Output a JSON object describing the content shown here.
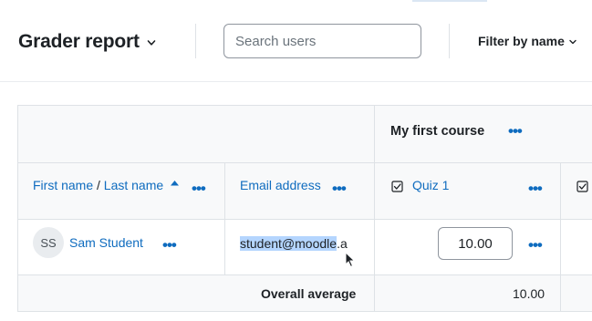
{
  "header": {
    "report_title": "Grader report",
    "search_placeholder": "Search users",
    "filter_label": "Filter by name"
  },
  "grid": {
    "course_name": "My first course",
    "columns": {
      "name": {
        "first": "First name",
        "separator": " / ",
        "last": "Last name"
      },
      "email": "Email address",
      "quiz": "Quiz 1"
    },
    "rows": [
      {
        "initials": "SS",
        "name": "Sam Student",
        "email_selected": "student@moodle",
        "email_rest": ".a",
        "grade": "10.00"
      }
    ],
    "average_label": "Overall average",
    "average_value": "10.00"
  },
  "colors": {
    "link": "#0f6cbf",
    "header_fill": "#f8f9fa",
    "border": "#dee2e6",
    "selection": "#b4d5fe"
  },
  "icons": [
    "chevron-down-icon",
    "sort-asc-icon",
    "more-actions-icon",
    "checkbox-icon",
    "mouse-cursor-icon"
  ]
}
